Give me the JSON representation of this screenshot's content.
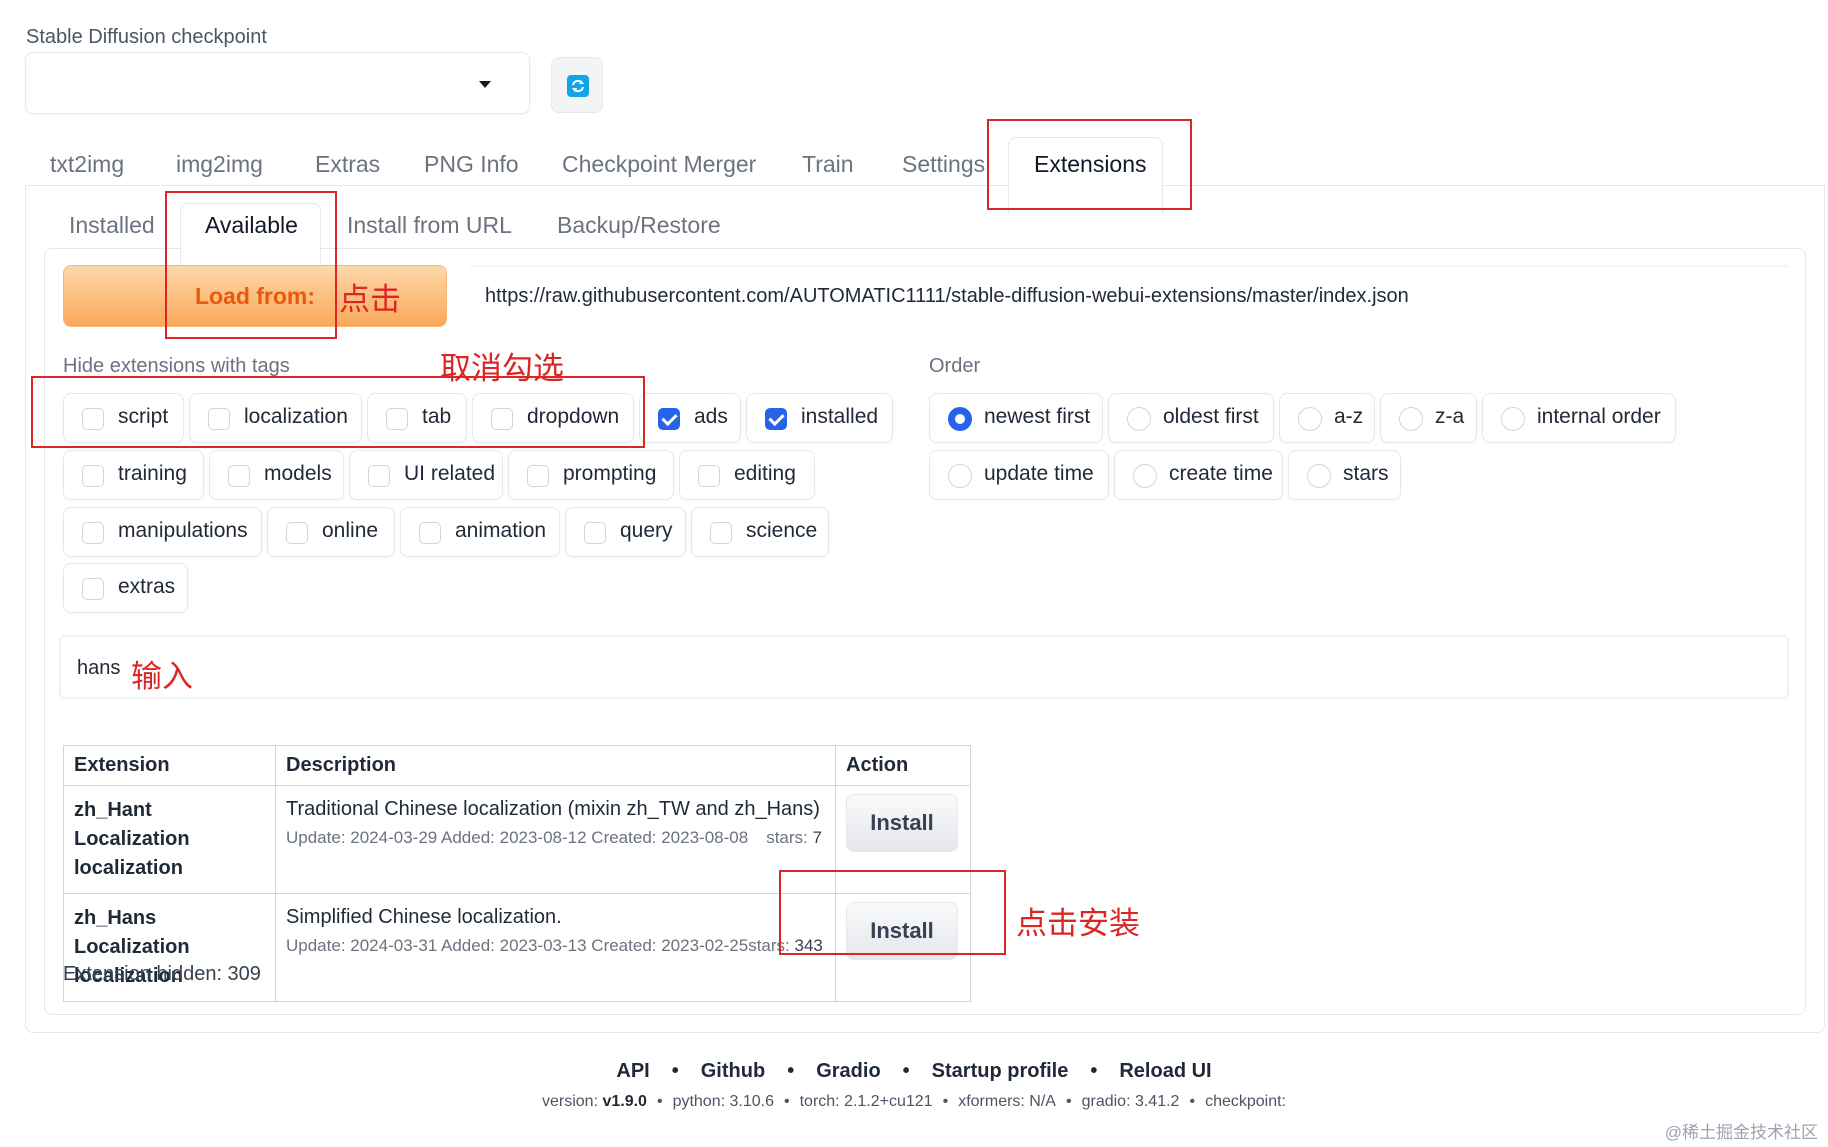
{
  "checkpoint": {
    "label": "Stable Diffusion checkpoint",
    "value": ""
  },
  "main_tabs": [
    {
      "label": "txt2img"
    },
    {
      "label": "img2img"
    },
    {
      "label": "Extras"
    },
    {
      "label": "PNG Info"
    },
    {
      "label": "Checkpoint Merger"
    },
    {
      "label": "Train"
    },
    {
      "label": "Settings"
    },
    {
      "label": "Extensions"
    }
  ],
  "sub_tabs": [
    {
      "label": "Installed"
    },
    {
      "label": "Available"
    },
    {
      "label": "Install from URL"
    },
    {
      "label": "Backup/Restore"
    }
  ],
  "load": {
    "button_label": "Load from:",
    "url": "https://raw.githubusercontent.com/AUTOMATIC1111/stable-diffusion-webui-extensions/master/index.json"
  },
  "hide_tags": {
    "label": "Hide extensions with tags",
    "items": [
      {
        "label": "script",
        "checked": false
      },
      {
        "label": "localization",
        "checked": false
      },
      {
        "label": "tab",
        "checked": false
      },
      {
        "label": "dropdown",
        "checked": false
      },
      {
        "label": "ads",
        "checked": true
      },
      {
        "label": "installed",
        "checked": true
      },
      {
        "label": "training",
        "checked": false
      },
      {
        "label": "models",
        "checked": false
      },
      {
        "label": "UI related",
        "checked": false
      },
      {
        "label": "prompting",
        "checked": false
      },
      {
        "label": "editing",
        "checked": false
      },
      {
        "label": "manipulations",
        "checked": false
      },
      {
        "label": "online",
        "checked": false
      },
      {
        "label": "animation",
        "checked": false
      },
      {
        "label": "query",
        "checked": false
      },
      {
        "label": "science",
        "checked": false
      },
      {
        "label": "extras",
        "checked": false
      }
    ]
  },
  "order": {
    "label": "Order",
    "items": [
      {
        "label": "newest first",
        "selected": true
      },
      {
        "label": "oldest first",
        "selected": false
      },
      {
        "label": "a-z",
        "selected": false
      },
      {
        "label": "z-a",
        "selected": false
      },
      {
        "label": "internal order",
        "selected": false
      },
      {
        "label": "update time",
        "selected": false
      },
      {
        "label": "create time",
        "selected": false
      },
      {
        "label": "stars",
        "selected": false
      }
    ]
  },
  "search": {
    "value": "hans"
  },
  "table": {
    "headers": [
      "Extension",
      "Description",
      "Action"
    ],
    "rows": [
      {
        "name": "zh_Hant Localization",
        "tag": "localization",
        "description": "Traditional Chinese localization (mixin zh_TW and zh_Hans)",
        "meta": "Update: 2024-03-29 Added: 2023-08-12 Created: 2023-08-08",
        "stars_label": "stars:",
        "stars": "7",
        "action": "Install"
      },
      {
        "name": "zh_Hans Localization",
        "tag": "localization",
        "description": "Simplified Chinese localization.",
        "meta": "Update: 2024-03-31 Added: 2023-03-13 Created: 2023-02-25",
        "stars_label": "stars:",
        "stars": "343",
        "action": "Install"
      }
    ]
  },
  "hidden_count": "Extension hidden: 309",
  "footer": {
    "links": [
      "API",
      "Github",
      "Gradio",
      "Startup profile",
      "Reload UI"
    ],
    "version": {
      "version_label": "version:",
      "version": "v1.9.0",
      "python": "python: 3.10.6",
      "torch": "torch: 2.1.2+cu121",
      "xformers": "xformers: N/A",
      "gradio": "gradio: 3.41.2",
      "checkpoint": "checkpoint:"
    },
    "sep": "•"
  },
  "annotations": {
    "click": "点击",
    "uncheck": "取消勾选",
    "input": "输入",
    "click_install": "点击安装"
  },
  "watermark": "@稀土掘金技术社区",
  "colors": {
    "accent": "#2563eb",
    "annotation": "#dc2626",
    "load_button": "#ea580c"
  },
  "icons": {
    "refresh": "refresh-icon",
    "dropdown": "chevron-down-icon"
  }
}
